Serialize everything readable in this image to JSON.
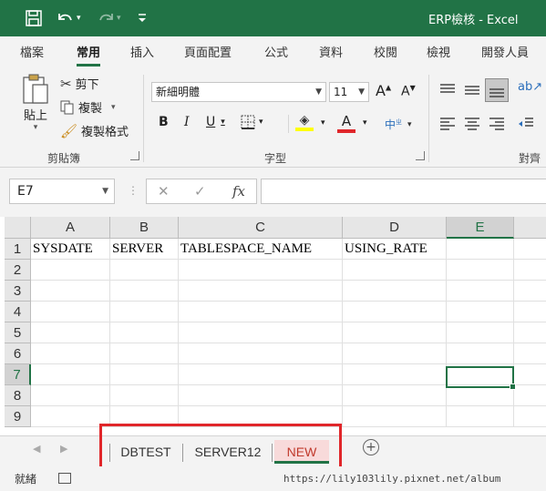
{
  "window": {
    "title": "ERP檢核 - Excel",
    "accent_color": "#217346"
  },
  "ribbon_tabs": [
    "檔案",
    "常用",
    "插入",
    "頁面配置",
    "公式",
    "資料",
    "校閱",
    "檢視",
    "開發人員"
  ],
  "active_tab": "常用",
  "clipboard_group": {
    "paste_label": "貼上",
    "cut_label": "剪下",
    "copy_label": "複製",
    "format_painter_label": "複製格式",
    "group_label": "剪貼簿"
  },
  "font_group": {
    "font_name": "新細明體",
    "font_size": "11",
    "bold": "B",
    "italic": "I",
    "underline": "U",
    "font_color_glyph": "A",
    "group_label": "字型"
  },
  "alignment_group": {
    "group_label": "對齊"
  },
  "formula_bar": {
    "name_box": "E7",
    "formula": ""
  },
  "sheet": {
    "columns": [
      "A",
      "B",
      "C",
      "D",
      "E"
    ],
    "selected_column": "E",
    "rows": [
      "1",
      "2",
      "3",
      "4",
      "5",
      "6",
      "7",
      "8",
      "9"
    ],
    "selected_row": "7",
    "row1": {
      "A": "SYSDATE",
      "B": "SERVER",
      "C": "TABLESPACE_NAME",
      "D": "USING_RATE"
    },
    "active_cell": "E7"
  },
  "sheet_tabs": [
    {
      "name": "DBTEST",
      "active": false
    },
    {
      "name": "SERVER12",
      "active": false
    },
    {
      "name": "NEW",
      "active": true
    }
  ],
  "status": {
    "ready_text": "就緒",
    "watermark": "https://lily103lily.pixnet.net/album"
  }
}
